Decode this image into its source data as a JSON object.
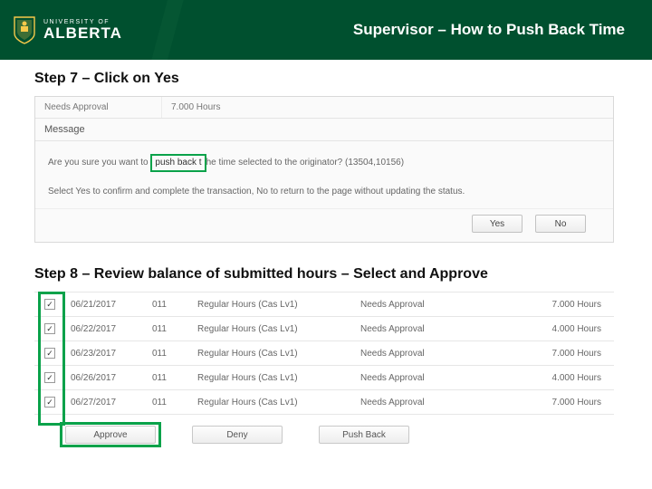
{
  "header": {
    "logo_university": "UNIVERSITY OF",
    "logo_name": "ALBERTA",
    "title": "Supervisor – How to Push Back Time"
  },
  "step7": {
    "heading": "Step 7 – Click on Yes",
    "top_col_a": "Needs Approval",
    "top_col_b": "7.000 Hours",
    "msg_title": "Message",
    "line1_pre": "Are you sure you want to ",
    "line1_highlight": "push back t",
    "line1_post": "he time selected to the originator? (13504,10156)",
    "line2": "Select Yes to confirm and complete the transaction, No to return to the page without updating the status.",
    "yes": "Yes",
    "no": "No"
  },
  "step8": {
    "heading": "Step 8 – Review balance of submitted hours – Select and Approve",
    "rows": [
      {
        "date": "06/21/2017",
        "code": "011",
        "desc": "Regular Hours (Cas Lv1)",
        "status": "Needs Approval",
        "hours": "7.000 Hours"
      },
      {
        "date": "06/22/2017",
        "code": "011",
        "desc": "Regular Hours (Cas Lv1)",
        "status": "Needs Approval",
        "hours": "4.000 Hours"
      },
      {
        "date": "06/23/2017",
        "code": "011",
        "desc": "Regular Hours (Cas Lv1)",
        "status": "Needs Approval",
        "hours": "7.000 Hours"
      },
      {
        "date": "06/26/2017",
        "code": "011",
        "desc": "Regular Hours (Cas Lv1)",
        "status": "Needs Approval",
        "hours": "4.000 Hours"
      },
      {
        "date": "06/27/2017",
        "code": "011",
        "desc": "Regular Hours (Cas Lv1)",
        "status": "Needs Approval",
        "hours": "7.000 Hours"
      }
    ],
    "approve": "Approve",
    "deny": "Deny",
    "pushback": "Push Back"
  }
}
